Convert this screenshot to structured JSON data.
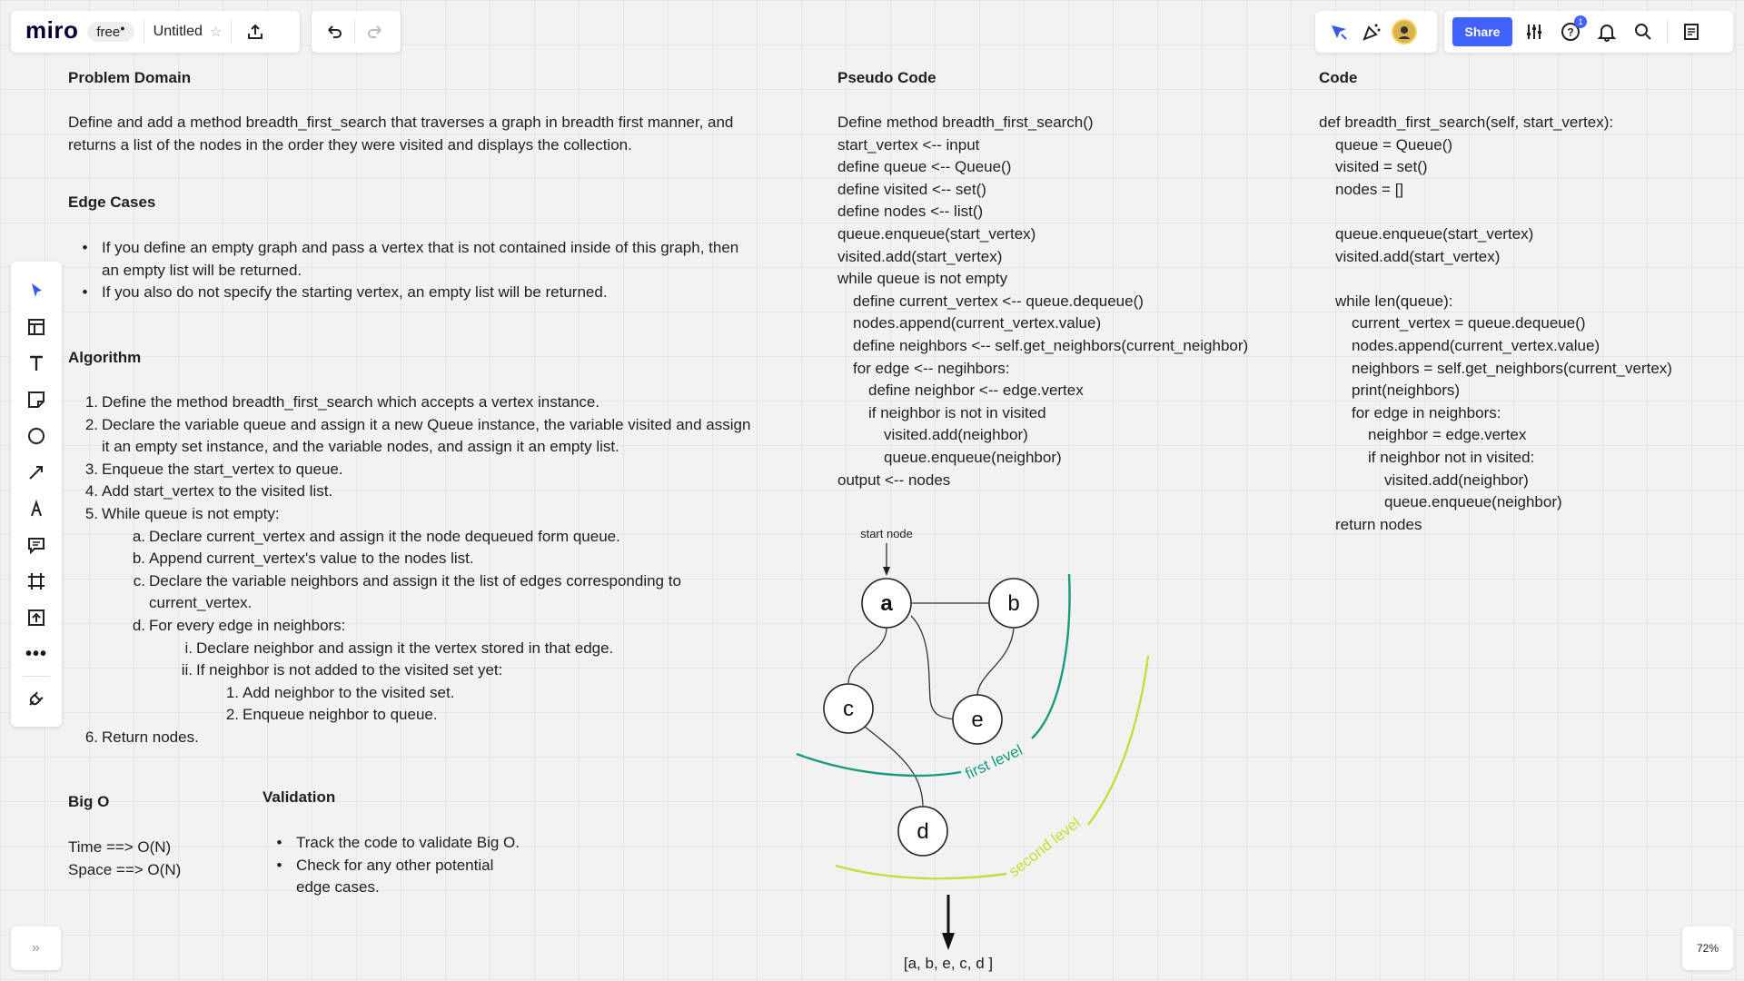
{
  "toolbar": {
    "logo": "miro",
    "plan_badge": "free",
    "board_title": "Untitled",
    "share_label": "Share",
    "notification_count": "1",
    "zoom": "72%",
    "expand": "»"
  },
  "problem_domain": {
    "heading": "Problem Domain",
    "text_line1": "Define and add a method breadth_first_search that traverses a graph in breadth first manner, and",
    "text_line2": "returns a list of the nodes in the order they were visited and displays the collection."
  },
  "edge_cases": {
    "heading": "Edge Cases",
    "items": [
      {
        "line1": "If you define an empty graph and pass a vertex that is not contained inside of this graph, then",
        "line2": "an empty list will be returned."
      },
      {
        "line1": "If you also do not specify the starting vertex, an empty list will be returned.",
        "line2": ""
      }
    ]
  },
  "algorithm": {
    "heading": "Algorithm",
    "lines": [
      {
        "marker": "1.",
        "text": "Define the method breadth_first_search which accepts a vertex instance.",
        "indent": 0
      },
      {
        "marker": "2.",
        "text": "Declare the variable queue and assign it a new Queue instance, the variable visited and assign",
        "indent": 0
      },
      {
        "marker": "",
        "text": "it an empty set instance, and the variable nodes, and assign it an empty list.",
        "indent": 0
      },
      {
        "marker": "3.",
        "text": "Enqueue the start_vertex to queue.",
        "indent": 0
      },
      {
        "marker": "4.",
        "text": "Add start_vertex to the visited list.",
        "indent": 0
      },
      {
        "marker": "5.",
        "text": "While queue is not empty:",
        "indent": 0
      },
      {
        "marker": "a.",
        "text": "Declare current_vertex and assign it the node dequeued form queue.",
        "indent": 1
      },
      {
        "marker": "b.",
        "text": "Append current_vertex's value to the nodes list.",
        "indent": 1
      },
      {
        "marker": "c.",
        "text": "Declare the variable neighbors and assign it the list of edges corresponding to",
        "indent": 1
      },
      {
        "marker": "",
        "text": "current_vertex.",
        "indent": 1
      },
      {
        "marker": "d.",
        "text": "For every edge in neighbors:",
        "indent": 1
      },
      {
        "marker": "i.",
        "text": "Declare neighbor and assign it the vertex stored in that edge.",
        "indent": 2
      },
      {
        "marker": "ii.",
        "text": "If neighbor is not added to the visited set yet:",
        "indent": 2
      },
      {
        "marker": "1.",
        "text": "Add neighbor to the visited set.",
        "indent": 3
      },
      {
        "marker": "2.",
        "text": "Enqueue neighbor to queue.",
        "indent": 3
      },
      {
        "marker": "6.",
        "text": "Return nodes.",
        "indent": 0
      }
    ]
  },
  "big_o": {
    "heading": "Big O",
    "time": "Time ==> O(N)",
    "space": "Space ==> O(N)"
  },
  "validation": {
    "heading": "Validation",
    "item1": "Track the code to validate Big O.",
    "item2_line1": "Check for any other potential",
    "item2_line2": "edge cases."
  },
  "pseudo_code": {
    "heading": "Pseudo Code",
    "lines": [
      {
        "indent": 0,
        "text": "Define method breadth_first_search()"
      },
      {
        "indent": 0,
        "text": "start_vertex <-- input"
      },
      {
        "indent": 0,
        "text": "define queue <-- Queue()"
      },
      {
        "indent": 0,
        "text": "define visited <-- set()"
      },
      {
        "indent": 0,
        "text": "define nodes <-- list()"
      },
      {
        "indent": 0,
        "text": "queue.enqueue(start_vertex)"
      },
      {
        "indent": 0,
        "text": "visited.add(start_vertex)"
      },
      {
        "indent": 0,
        "text": "while queue is not empty"
      },
      {
        "indent": 1,
        "text": "define current_vertex <-- queue.dequeue()"
      },
      {
        "indent": 1,
        "text": "nodes.append(current_vertex.value)"
      },
      {
        "indent": 1,
        "text": "define neighbors <-- self.get_neighbors(current_neighbor)"
      },
      {
        "indent": 1,
        "text": "for edge <-- negihbors:"
      },
      {
        "indent": 2,
        "text": "define neighbor <-- edge.vertex"
      },
      {
        "indent": 2,
        "text": "if neighbor is not in visited"
      },
      {
        "indent": 3,
        "text": "visited.add(neighbor)"
      },
      {
        "indent": 3,
        "text": "queue.enqueue(neighbor)"
      },
      {
        "indent": 0,
        "text": "output <-- nodes"
      }
    ]
  },
  "code": {
    "heading": "Code",
    "lines": [
      {
        "indent": 0,
        "text": "def breadth_first_search(self, start_vertex):"
      },
      {
        "indent": 1,
        "text": "queue = Queue()"
      },
      {
        "indent": 1,
        "text": "visited = set()"
      },
      {
        "indent": 1,
        "text": "nodes = []"
      },
      {
        "indent": 1,
        "text": ""
      },
      {
        "indent": 1,
        "text": "queue.enqueue(start_vertex)"
      },
      {
        "indent": 1,
        "text": "visited.add(start_vertex)"
      },
      {
        "indent": 1,
        "text": ""
      },
      {
        "indent": 1,
        "text": "while len(queue):"
      },
      {
        "indent": 2,
        "text": "current_vertex = queue.dequeue()"
      },
      {
        "indent": 2,
        "text": "nodes.append(current_vertex.value)"
      },
      {
        "indent": 2,
        "text": "neighbors = self.get_neighbors(current_vertex)"
      },
      {
        "indent": 2,
        "text": "print(neighbors)"
      },
      {
        "indent": 2,
        "text": "for edge in neighbors:"
      },
      {
        "indent": 3,
        "text": "neighbor = edge.vertex"
      },
      {
        "indent": 3,
        "text": "if neighbor not in visited:"
      },
      {
        "indent": 4,
        "text": "visited.add(neighbor)"
      },
      {
        "indent": 4,
        "text": "queue.enqueue(neighbor)"
      },
      {
        "indent": 1,
        "text": "return nodes"
      }
    ]
  },
  "graph": {
    "start_label": "start node",
    "nodes": {
      "a": "a",
      "b": "b",
      "c": "c",
      "d": "d",
      "e": "e"
    },
    "first_level": "first level",
    "second_level": "second level",
    "result": "[a, b, e, c, d ]",
    "colors": {
      "first": "#1a9b7d",
      "second": "#c6dd3b"
    }
  }
}
